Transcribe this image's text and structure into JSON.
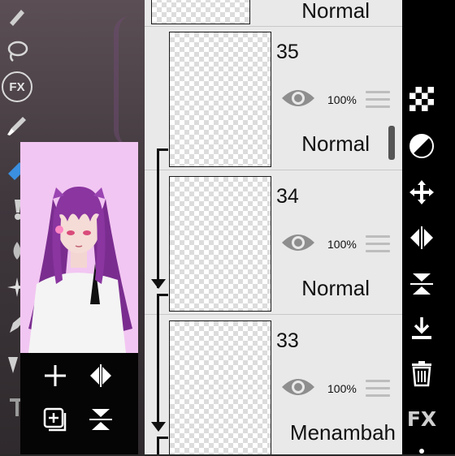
{
  "left_toolbar": {
    "fx_label": "FX",
    "tools": [
      "lasso-icon",
      "fx-filter-icon",
      "brush-icon",
      "eraser-icon",
      "smudge-icon",
      "blur-icon",
      "pen-icon",
      "fill-icon",
      "text-icon"
    ]
  },
  "preview": {
    "artwork": "character-preview",
    "buttons": [
      "add-layer-icon",
      "flip-horizontal-icon",
      "add-layer-copy-icon",
      "flip-vertical-icon"
    ]
  },
  "layers": [
    {
      "number": "",
      "blend": "Normal",
      "opacity": ""
    },
    {
      "number": "35",
      "blend": "Normal",
      "opacity": "100%"
    },
    {
      "number": "34",
      "blend": "Normal",
      "opacity": "100%"
    },
    {
      "number": "33",
      "blend": "Menambah",
      "opacity": "100%"
    }
  ],
  "right_toolbar": {
    "tools": [
      "transparency-checker-icon",
      "blend-mode-icon",
      "move-icon",
      "flip-horizontal-icon",
      "flip-vertical-icon",
      "merge-down-icon",
      "delete-icon"
    ],
    "fx_label": "FX"
  },
  "colors": {
    "panel_bg": "#e9e9e9",
    "toolbar_bg": "#000000",
    "preview_bg": "#f0c8f0",
    "accent_blue": "#3b8fe0"
  }
}
